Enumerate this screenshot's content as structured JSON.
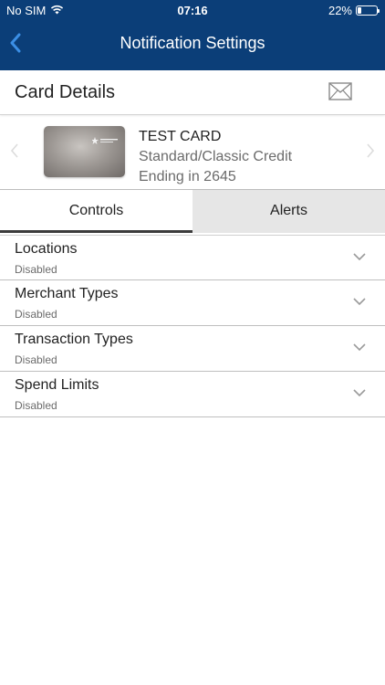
{
  "status_bar": {
    "carrier": "No SIM",
    "time": "07:16",
    "battery": "22%",
    "battery_level": 0.22
  },
  "header": {
    "title": "Notification Settings",
    "back_icon": "chevron-left-icon"
  },
  "section": {
    "title": "Card Details",
    "mail_icon": "envelope-icon"
  },
  "card": {
    "name": "TEST CARD",
    "type": "Standard/Classic Credit",
    "ending": "Ending in 2645"
  },
  "tabs": [
    {
      "label": "Controls",
      "active": true
    },
    {
      "label": "Alerts",
      "active": false
    }
  ],
  "controls": [
    {
      "title": "Locations",
      "status": "Disabled"
    },
    {
      "title": "Merchant Types",
      "status": "Disabled"
    },
    {
      "title": "Transaction Types",
      "status": "Disabled"
    },
    {
      "title": "Spend Limits",
      "status": "Disabled"
    }
  ],
  "colors": {
    "header_bg": "#0b3e78",
    "accent": "#3b8fe6",
    "inactive_tab": "#e6e6e6"
  }
}
